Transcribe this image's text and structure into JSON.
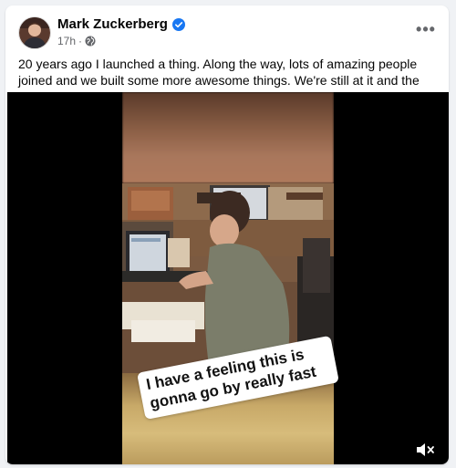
{
  "post": {
    "author_name": "Mark Zuckerberg",
    "verified": true,
    "timestamp": "17h",
    "separator": "·",
    "audience_icon": "globe-icon",
    "more_icon": "more-horizontal-icon",
    "text": "20 years ago I launched a thing. Along the way, lots of amazing people joined and we built some more awesome things. We're still at it and the best is yet to come."
  },
  "video": {
    "caption": "I have a feeling this is gonna go by really fast",
    "mute_icon": "volume-muted-icon",
    "muted": true
  },
  "colors": {
    "page_bg": "#f0f2f5",
    "card_bg": "#ffffff",
    "text_primary": "#050505",
    "text_secondary": "#65676b",
    "verified_blue": "#1877f2"
  }
}
